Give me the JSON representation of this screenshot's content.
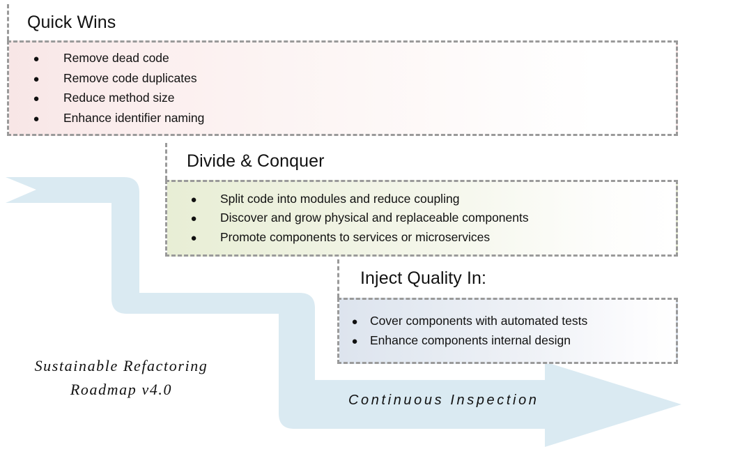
{
  "diagram": {
    "caption_line1": "Sustainable Refactoring",
    "caption_line2": "Roadmap v4.0",
    "flow_label": "Continuous Inspection",
    "ribbon_color": "#daeaf2",
    "border_color": "#9a9a9a",
    "bullet_glyph": "●"
  },
  "stages": [
    {
      "id": "quick-wins",
      "title": "Quick Wins",
      "accent": "#f8e6e6",
      "items": [
        "Remove dead code",
        "Remove code duplicates",
        "Reduce method size",
        "Enhance identifier naming"
      ]
    },
    {
      "id": "divide-conquer",
      "title": "Divide & Conquer",
      "accent": "#e8eed5",
      "items": [
        "Split code into modules and reduce coupling",
        "Discover and grow physical and replaceable components",
        "Promote components to services or microservices"
      ]
    },
    {
      "id": "inject-quality",
      "title": "Inject Quality In:",
      "accent": "#dde4ee",
      "items": [
        "Cover components with automated tests",
        "Enhance components internal design"
      ]
    }
  ]
}
